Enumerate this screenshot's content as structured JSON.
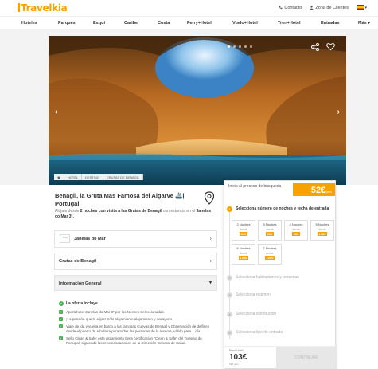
{
  "header": {
    "logo": "Travelkia",
    "contact": "Contacto",
    "client_zone": "Zona de Clientes"
  },
  "nav": [
    "Hoteles",
    "Parques",
    "Esquí",
    "Caribe",
    "Costa",
    "Ferry+Hotel",
    "Vuelo+Hotel",
    "Tren+Hotel",
    "Entradas",
    "Más"
  ],
  "hero": {
    "tags": [
      "HOTEL",
      "DESTINO",
      "CRUTAS DE BENAGIL"
    ]
  },
  "product": {
    "title": "Benagil, la Gruta Más Famosa del Algarve 🚢| Portugal",
    "subtitle_pre": "Alójate desde",
    "subtitle_bold1": "2 noches con visita a las Grutas de Benagil",
    "subtitle_mid": "con estancia en el",
    "subtitle_bold2": "3anelas do Mar 3*."
  },
  "sections": {
    "hotel": "3anelas do Mar",
    "hotel_logo": "TYM",
    "caves": "Grutas de Benagil",
    "info": "Información General"
  },
  "included": {
    "heading": "La oferta incluye",
    "items": [
      "Apartahotel 3anelas do Mar 3* por las Noches Seleccionadas.",
      "¡La pensión que tú elijas! Sólo alojamiento alojamiento y desayuno.",
      "Viaje de ida y vuelta en barco a las famosas Cuevas de Benagil y Observación de delfines desde el puerto de Albufeira para todas las personas de la reserva, válido para 1 día.",
      "Sello Clean & Safe: este alojamiento tiene certificación \"Clean & Safe\" del Turismo de Portugal, siguiendo las recomendaciones de la Dirección General de Salud."
    ]
  },
  "booking": {
    "panel_title": "Inicio al proceso de búsqueda",
    "price": "52€",
    "price_unit": "/pers",
    "steps": [
      "Selecciona número de noches y fecha de entrada",
      "Selecciona habitaciones y personas",
      "Selecciona regimen",
      "Selecciona distribución",
      "Selecciona tipo de entrada"
    ],
    "options": [
      {
        "n": "2 Noches",
        "d": "desde",
        "p": "52€"
      },
      {
        "n": "3 Noches",
        "d": "desde",
        "p": "65€"
      },
      {
        "n": "4 Noches",
        "d": "desde",
        "p": "96€"
      },
      {
        "n": "5 Noches",
        "d": "desde",
        "p": "109€"
      },
      {
        "n": "6 Noches",
        "d": "desde",
        "p": "122€"
      },
      {
        "n": "7 Noches",
        "d": "desde",
        "p": "126€"
      }
    ],
    "total_label": "Precio total",
    "total": "103€",
    "total_sub": "52€ pers",
    "continue": "CONTINUAR"
  }
}
